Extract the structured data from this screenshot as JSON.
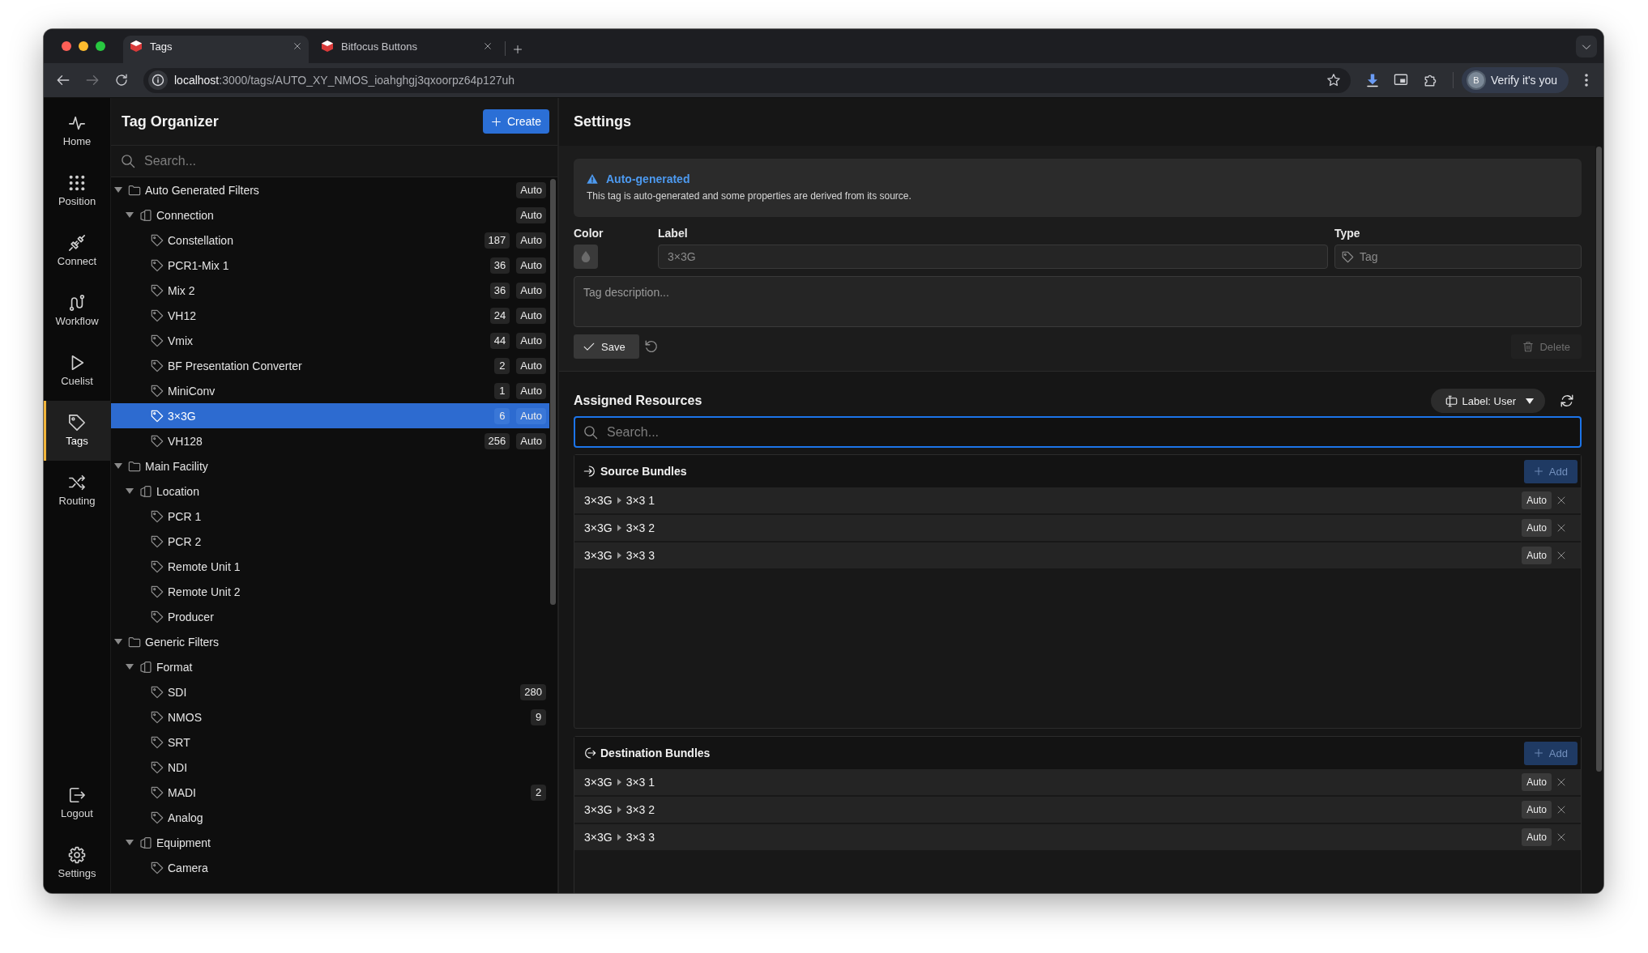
{
  "browser": {
    "tabs": [
      {
        "title": "Tags",
        "selected": true
      },
      {
        "title": "Bitfocus Buttons",
        "selected": false
      }
    ],
    "address": {
      "host": "localhost",
      "path": ":3000/tags/AUTO_XY_NMOS_ioahghgj3qxoorpz64p127uh"
    },
    "profile": {
      "initial": "B",
      "label": "Verify it's you"
    }
  },
  "nav": {
    "items": [
      {
        "label": "Home",
        "selected": false
      },
      {
        "label": "Position",
        "selected": false
      },
      {
        "label": "Connect",
        "selected": false
      },
      {
        "label": "Workflow",
        "selected": false
      },
      {
        "label": "Cuelist",
        "selected": false
      },
      {
        "label": "Tags",
        "selected": true
      },
      {
        "label": "Routing",
        "selected": false
      }
    ],
    "bottom_items": [
      {
        "label": "Logout",
        "selected": false
      },
      {
        "label": "Settings",
        "selected": false
      }
    ]
  },
  "tag_organizer": {
    "title": "Tag Organizer",
    "create_button": "Create",
    "search": {
      "placeholder": "Search..."
    },
    "tree": [
      {
        "label": "Auto Generated Filters",
        "kind": "folder",
        "expanded": true,
        "selected": false,
        "badge": "Auto",
        "children": [
          {
            "label": "Connection",
            "kind": "group",
            "expanded": true,
            "selected": false,
            "badge": "Auto",
            "children": [
              {
                "label": "Constellation",
                "kind": "tag",
                "selected": false,
                "count": "187",
                "badge": "Auto"
              },
              {
                "label": "PCR1-Mix 1",
                "kind": "tag",
                "selected": false,
                "count": "36",
                "badge": "Auto"
              },
              {
                "label": "Mix 2",
                "kind": "tag",
                "selected": false,
                "count": "36",
                "badge": "Auto"
              },
              {
                "label": "VH12",
                "kind": "tag",
                "selected": false,
                "count": "24",
                "badge": "Auto"
              },
              {
                "label": "Vmix",
                "kind": "tag",
                "selected": false,
                "count": "44",
                "badge": "Auto"
              },
              {
                "label": "BF Presentation Converter",
                "kind": "tag",
                "selected": false,
                "count": "2",
                "badge": "Auto"
              },
              {
                "label": "MiniConv",
                "kind": "tag",
                "selected": false,
                "count": "1",
                "badge": "Auto"
              },
              {
                "label": "3×3G",
                "kind": "tag",
                "selected": true,
                "count": "6",
                "badge": "Auto"
              },
              {
                "label": "VH128",
                "kind": "tag",
                "selected": false,
                "count": "256",
                "badge": "Auto"
              }
            ]
          }
        ]
      },
      {
        "label": "Main Facility",
        "kind": "folder",
        "expanded": true,
        "selected": false,
        "children": [
          {
            "label": "Location",
            "kind": "group",
            "expanded": true,
            "selected": false,
            "children": [
              {
                "label": "PCR 1",
                "kind": "tag",
                "selected": false
              },
              {
                "label": "PCR 2",
                "kind": "tag",
                "selected": false
              },
              {
                "label": "Remote Unit 1",
                "kind": "tag",
                "selected": false
              },
              {
                "label": "Remote Unit 2",
                "kind": "tag",
                "selected": false
              },
              {
                "label": "Producer",
                "kind": "tag",
                "selected": false
              }
            ]
          }
        ]
      },
      {
        "label": "Generic Filters",
        "kind": "folder",
        "expanded": true,
        "selected": false,
        "children": [
          {
            "label": "Format",
            "kind": "group",
            "expanded": true,
            "selected": false,
            "children": [
              {
                "label": "SDI",
                "kind": "tag",
                "selected": false,
                "count": "280"
              },
              {
                "label": "NMOS",
                "kind": "tag",
                "selected": false,
                "count": "9"
              },
              {
                "label": "SRT",
                "kind": "tag",
                "selected": false
              },
              {
                "label": "NDI",
                "kind": "tag",
                "selected": false
              },
              {
                "label": "MADI",
                "kind": "tag",
                "selected": false,
                "count": "2"
              },
              {
                "label": "Analog",
                "kind": "tag",
                "selected": false
              }
            ]
          },
          {
            "label": "Equipment",
            "kind": "group",
            "expanded": true,
            "selected": false,
            "children": [
              {
                "label": "Camera",
                "kind": "tag",
                "selected": false
              }
            ]
          }
        ]
      }
    ]
  },
  "settings": {
    "title": "Settings",
    "notice": {
      "title": "Auto-generated",
      "text": "This tag is auto-generated and some properties are derived from its source."
    },
    "color_label": "Color",
    "label_field": {
      "label": "Label",
      "value": "3×3G",
      "disabled": true
    },
    "type_field": {
      "label": "Type",
      "value": "Tag",
      "disabled": true
    },
    "description": {
      "placeholder": "Tag description..."
    },
    "save_button": "Save",
    "delete_button": {
      "label": "Delete",
      "disabled": true
    }
  },
  "assigned_resources": {
    "title": "Assigned Resources",
    "label_menu": "Label: User",
    "search": {
      "placeholder": "Search...",
      "focused": true
    },
    "sections": [
      {
        "kind": "source",
        "title": "Source Bundles",
        "add_button": {
          "label": "Add",
          "disabled": true
        },
        "rows": [
          {
            "device": "3×3G",
            "name": "3×3 1",
            "badge": "Auto"
          },
          {
            "device": "3×3G",
            "name": "3×3 2",
            "badge": "Auto"
          },
          {
            "device": "3×3G",
            "name": "3×3 3",
            "badge": "Auto"
          }
        ]
      },
      {
        "kind": "destination",
        "title": "Destination Bundles",
        "add_button": {
          "label": "Add",
          "disabled": true
        },
        "rows": [
          {
            "device": "3×3G",
            "name": "3×3 1",
            "badge": "Auto"
          },
          {
            "device": "3×3G",
            "name": "3×3 2",
            "badge": "Auto"
          },
          {
            "device": "3×3G",
            "name": "3×3 3",
            "badge": "Auto"
          }
        ]
      }
    ]
  }
}
